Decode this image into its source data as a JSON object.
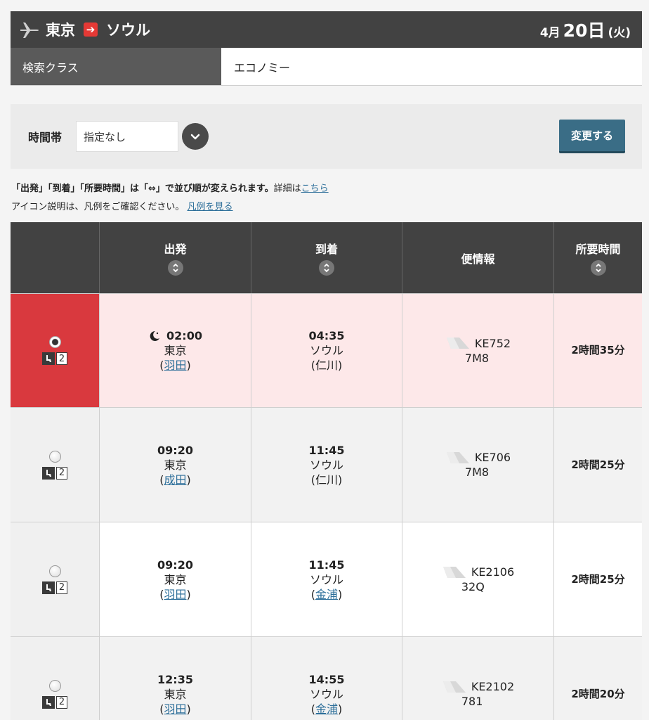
{
  "header": {
    "origin": "東京",
    "destination": "ソウル",
    "month": "4月",
    "day": "20日",
    "weekday": "(火)"
  },
  "search_class": {
    "label": "検索クラス",
    "value": "エコノミー"
  },
  "filter": {
    "time_label": "時間帯",
    "time_value": "指定なし",
    "change_button": "変更する"
  },
  "notes": {
    "sort_note_bold": "「出発」「到着」「所要時間」は「⇔」で並び順が変えられます。",
    "sort_note_detail": "詳細は",
    "sort_note_link": "こちら",
    "legend_note": "アイコン説明は、凡例をご確認ください。",
    "legend_link": "凡例を見る"
  },
  "table": {
    "columns": [
      "出発",
      "到着",
      "便情報",
      "所要時間"
    ],
    "rows": [
      {
        "selected": true,
        "seats": "2",
        "night": true,
        "dep_time": "02:00",
        "dep_city": "東京",
        "dep_airport": "羽田",
        "arr_time": "04:35",
        "arr_city": "ソウル",
        "arr_airport": "仁川",
        "arr_link": false,
        "flight": "KE752",
        "aircraft": "7M8",
        "duration": "2時間35分"
      },
      {
        "selected": false,
        "seats": "2",
        "night": false,
        "dep_time": "09:20",
        "dep_city": "東京",
        "dep_airport": "成田",
        "arr_time": "11:45",
        "arr_city": "ソウル",
        "arr_airport": "仁川",
        "arr_link": false,
        "flight": "KE706",
        "aircraft": "7M8",
        "duration": "2時間25分"
      },
      {
        "selected": false,
        "seats": "2",
        "night": false,
        "dep_time": "09:20",
        "dep_city": "東京",
        "dep_airport": "羽田",
        "arr_time": "11:45",
        "arr_city": "ソウル",
        "arr_airport": "金浦",
        "arr_link": true,
        "flight": "KE2106",
        "aircraft": "32Q",
        "duration": "2時間25分"
      },
      {
        "selected": false,
        "seats": "2",
        "night": false,
        "dep_time": "12:35",
        "dep_city": "東京",
        "dep_airport": "羽田",
        "arr_time": "14:55",
        "arr_city": "ソウル",
        "arr_airport": "金浦",
        "arr_link": true,
        "flight": "KE2102",
        "aircraft": "781",
        "duration": "2時間20分"
      }
    ]
  },
  "colors": {
    "header_bg": "#424242",
    "selected_row": "#fde8e9",
    "selected_cell": "#d9393e",
    "button": "#3a6d86",
    "link": "#2d6f9a"
  }
}
